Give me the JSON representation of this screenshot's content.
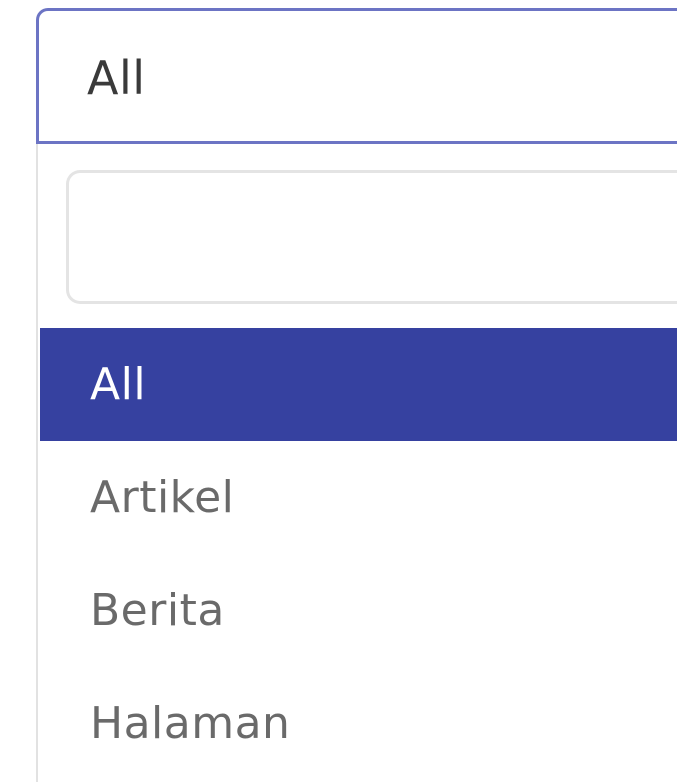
{
  "select": {
    "value": "All"
  },
  "dropdown": {
    "search_value": "",
    "options": [
      {
        "label": "All",
        "selected": true
      },
      {
        "label": "Artikel",
        "selected": false
      },
      {
        "label": "Berita",
        "selected": false
      },
      {
        "label": "Halaman",
        "selected": false
      }
    ]
  },
  "colors": {
    "accent": "#3641a0",
    "focus_border": "#6c74c4",
    "option_text": "#6a6a6a",
    "selected_text": "#ffffff"
  }
}
